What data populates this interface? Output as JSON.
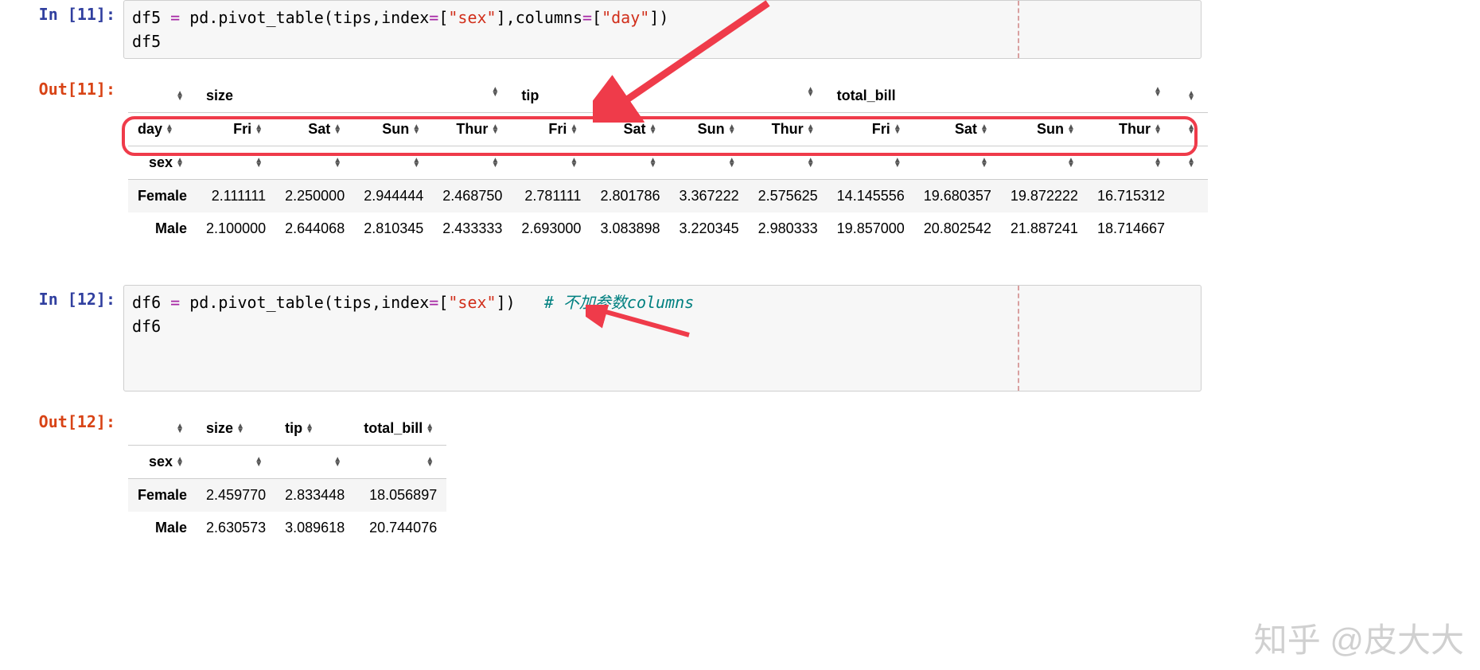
{
  "cell1": {
    "in_label": "In [11]:",
    "out_label": "Out[11]:",
    "code_line1_parts": {
      "var": "df5 ",
      "op": "=",
      "rest1": " pd.pivot_table(tips,index",
      "op2": "=",
      "br1": "[",
      "str1": "\"sex\"",
      "br2": "],columns",
      "op3": "=",
      "br3": "[",
      "str2": "\"day\"",
      "br4": "])"
    },
    "code_line2": "df5",
    "table": {
      "top_groups": [
        "size",
        "tip",
        "total_bill"
      ],
      "day_label": "day",
      "days": [
        "Fri",
        "Sat",
        "Sun",
        "Thur",
        "Fri",
        "Sat",
        "Sun",
        "Thur",
        "Fri",
        "Sat",
        "Sun",
        "Thur"
      ],
      "sex_label": "sex",
      "rows": [
        {
          "label": "Female",
          "vals": [
            "2.111111",
            "2.250000",
            "2.944444",
            "2.468750",
            "2.781111",
            "2.801786",
            "3.367222",
            "2.575625",
            "14.145556",
            "19.680357",
            "19.872222",
            "16.715312"
          ]
        },
        {
          "label": "Male",
          "vals": [
            "2.100000",
            "2.644068",
            "2.810345",
            "2.433333",
            "2.693000",
            "3.083898",
            "3.220345",
            "2.980333",
            "19.857000",
            "20.802542",
            "21.887241",
            "18.714667"
          ]
        }
      ]
    }
  },
  "cell2": {
    "in_label": "In [12]:",
    "out_label": "Out[12]:",
    "code_line1_parts": {
      "var": "df6 ",
      "op": "=",
      "rest1": " pd.pivot_table(tips,index",
      "op2": "=",
      "br1": "[",
      "str1": "\"sex\"",
      "br2": "])   ",
      "comment": "# 不加参数columns"
    },
    "code_line2": "df6",
    "table": {
      "cols": [
        "size",
        "tip",
        "total_bill"
      ],
      "sex_label": "sex",
      "rows": [
        {
          "label": "Female",
          "vals": [
            "2.459770",
            "2.833448",
            "18.056897"
          ]
        },
        {
          "label": "Male",
          "vals": [
            "2.630573",
            "3.089618",
            "20.744076"
          ]
        }
      ]
    }
  },
  "watermark": "知乎 @皮大大"
}
